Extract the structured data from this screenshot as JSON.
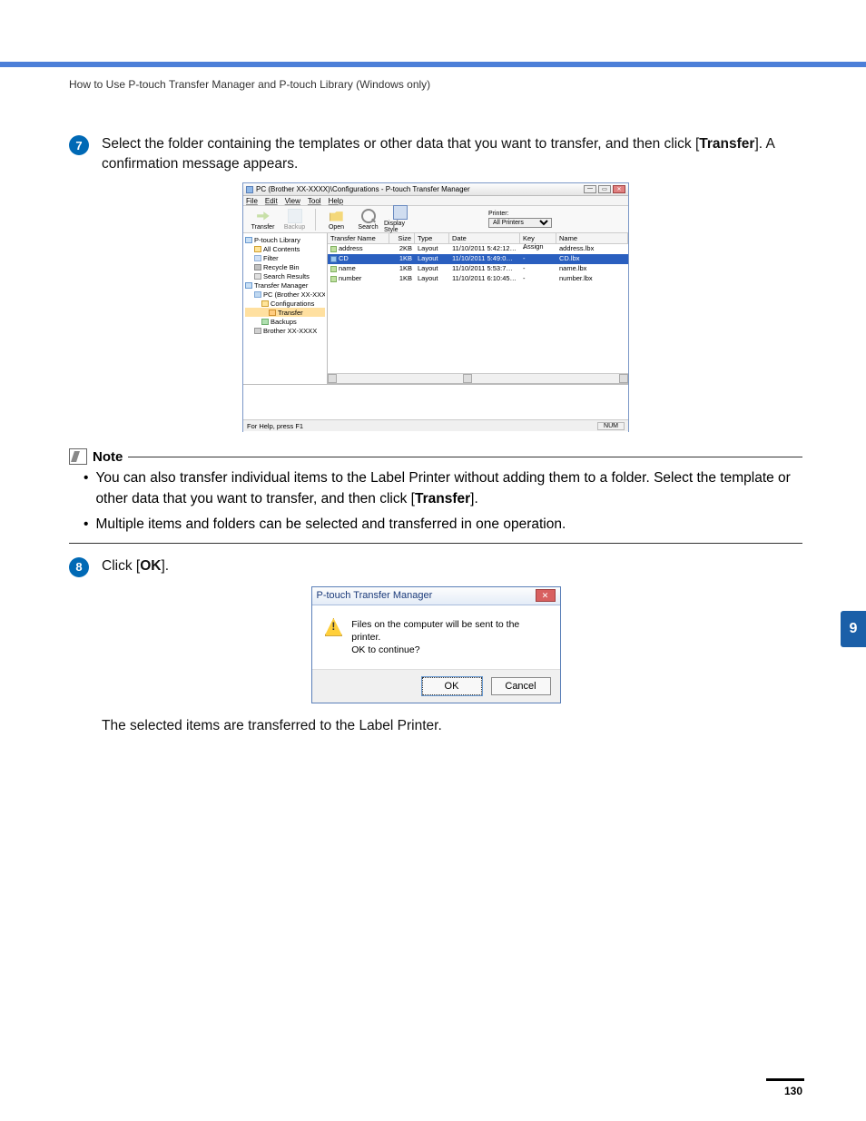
{
  "header": "How to Use P-touch Transfer Manager and P-touch Library (Windows only)",
  "step7": {
    "num": "7",
    "text_a": "Select the folder containing the templates or other data that you want to transfer, and then click [",
    "bold": "Transfer",
    "text_b": "]. A confirmation message appears."
  },
  "app_window": {
    "title": "PC (Brother XX-XXXX)\\Configurations - P-touch Transfer Manager",
    "menu": {
      "file": "File",
      "edit": "Edit",
      "view": "View",
      "tool": "Tool",
      "help": "Help"
    },
    "toolbar": {
      "transfer": "Transfer",
      "backup": "Backup",
      "open": "Open",
      "search": "Search",
      "display": "Display Style",
      "printer_label": "Printer:",
      "printer_value": "All Printers"
    },
    "tree": {
      "lib": "P-touch Library",
      "all": "All Contents",
      "filter": "Filter",
      "recycle": "Recycle Bin",
      "results": "Search Results",
      "tm": "Transfer Manager",
      "pc": "PC (Brother XX-XXXX)",
      "configs": "Configurations",
      "transfer": "Transfer",
      "backups": "Backups",
      "printer": "Brother XX-XXXX"
    },
    "list": {
      "headers": {
        "transfer_name": "Transfer Name",
        "size": "Size",
        "type": "Type",
        "date": "Date",
        "key_assign": "Key Assign",
        "name": "Name"
      },
      "rows": [
        {
          "transfer_name": "address",
          "size": "2KB",
          "type": "Layout",
          "date": "11/10/2011 5:42:12…",
          "key_assign": "-",
          "name": "address.lbx"
        },
        {
          "transfer_name": "CD",
          "size": "1KB",
          "type": "Layout",
          "date": "11/10/2011 5:49:0…",
          "key_assign": "-",
          "name": "CD.lbx",
          "selected": true
        },
        {
          "transfer_name": "name",
          "size": "1KB",
          "type": "Layout",
          "date": "11/10/2011 5:53:7…",
          "key_assign": "-",
          "name": "name.lbx"
        },
        {
          "transfer_name": "number",
          "size": "1KB",
          "type": "Layout",
          "date": "11/10/2011 6:10:45…",
          "key_assign": "-",
          "name": "number.lbx"
        }
      ]
    },
    "status": {
      "help": "For Help, press F1",
      "indicator": "NUM"
    }
  },
  "note": {
    "label": "Note",
    "b1_a": "You can also transfer individual items to the Label Printer without adding them to a folder. Select the template or other data that you want to transfer, and then click [",
    "b1_bold": "Transfer",
    "b1_b": "].",
    "b2": "Multiple items and folders can be selected and transferred in one operation."
  },
  "step8": {
    "num": "8",
    "text_a": "Click [",
    "bold": "OK",
    "text_b": "]."
  },
  "dialog": {
    "title": "P-touch Transfer Manager",
    "message": "Files on the computer will be sent to the printer.\nOK to continue?",
    "ok": "OK",
    "cancel": "Cancel"
  },
  "after_text": "The selected items are transferred to the Label Printer.",
  "side_tab": "9",
  "page_num": "130"
}
